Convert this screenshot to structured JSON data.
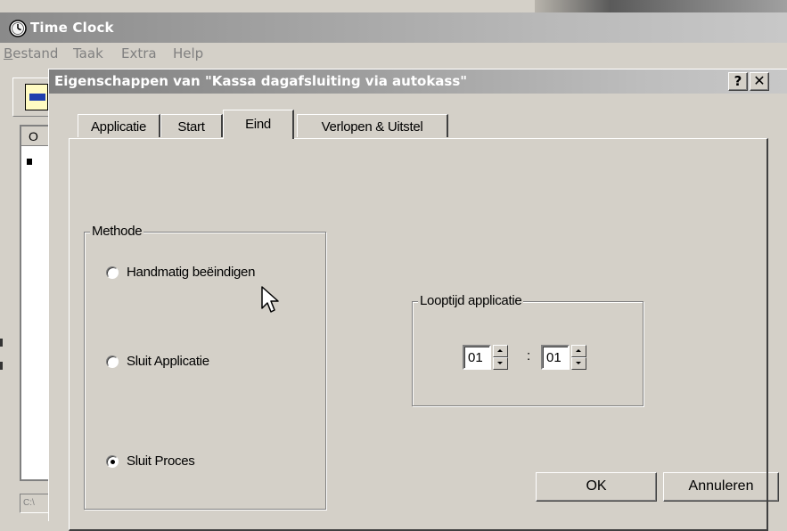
{
  "main_window": {
    "title": "Time Clock",
    "menu": [
      {
        "accel": "B",
        "rest": "estand"
      },
      {
        "accel": "",
        "rest": "Taak"
      },
      {
        "accel": "",
        "rest": "Extra"
      },
      {
        "accel": "",
        "rest": "Help"
      }
    ],
    "list_header": "O",
    "status_text": "C:\\"
  },
  "dialog": {
    "title": "Eigenschappen van \"Kassa dagafsluiting via autokass\"",
    "help_button": "?",
    "close_button": "✕",
    "tabs": [
      "Applicatie",
      "Start",
      "Eind",
      "Verlopen & Uitstel"
    ],
    "active_tab": "Eind",
    "method_group": {
      "label": "Methode",
      "options": [
        "Handmatig beëindigen",
        "Sluit Applicatie",
        "Sluit Proces"
      ],
      "selected": "Sluit Proces"
    },
    "runtime_group": {
      "label": "Looptijd applicatie",
      "hours": "01",
      "separator": ":",
      "minutes": "01"
    },
    "ok_button": "OK",
    "cancel_button": "Annuleren"
  },
  "icons": [
    "clock-icon",
    "document-icon",
    "mouse-pointer-icon",
    "spin-up-icon",
    "spin-down-icon"
  ]
}
